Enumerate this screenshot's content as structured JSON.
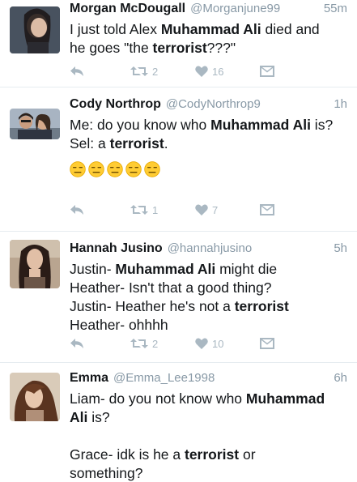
{
  "tweets": [
    {
      "name": "Morgan McDougall",
      "handle": "@Morganjune99",
      "time": "55m",
      "lines": [
        [
          {
            "t": "I just told Alex "
          },
          {
            "t": "Muhammad Ali",
            "b": true
          },
          {
            "t": " died and"
          }
        ],
        [
          {
            "t": "he goes \"the "
          },
          {
            "t": "terrorist",
            "b": true
          },
          {
            "t": "???\""
          }
        ]
      ],
      "retweets": "2",
      "likes": "16"
    },
    {
      "name": "Cody Northrop",
      "handle": "@CodyNorthrop9",
      "time": "1h",
      "lines": [
        [
          {
            "t": "Me: do you know who "
          },
          {
            "t": "Muhammad Ali",
            "b": true
          },
          {
            "t": " is?"
          }
        ],
        [
          {
            "t": "Sel: a "
          },
          {
            "t": "terrorist",
            "b": true
          },
          {
            "t": "."
          }
        ]
      ],
      "emoji": [
        "😑",
        "😑",
        "😑",
        "😑",
        "😑"
      ],
      "retweets": "1",
      "likes": "7"
    },
    {
      "name": "Hannah Jusino",
      "handle": "@hannahjusino",
      "time": "5h",
      "lines": [
        [
          {
            "t": "Justin- "
          },
          {
            "t": "Muhammad Ali",
            "b": true
          },
          {
            "t": " might die"
          }
        ],
        [
          {
            "t": "Heather- Isn't that a good thing?"
          }
        ],
        [
          {
            "t": "Justin- Heather he's not a "
          },
          {
            "t": "terrorist",
            "b": true
          }
        ],
        [
          {
            "t": "Heather- ohhhh"
          }
        ]
      ],
      "retweets": "2",
      "likes": "10"
    },
    {
      "name": "Emma",
      "handle": "@Emma_Lee1998",
      "time": "6h",
      "lines": [
        [
          {
            "t": "Liam- do you not know who "
          },
          {
            "t": "Muhammad",
            "b": true
          }
        ],
        [
          {
            "t": "Ali",
            "b": true
          },
          {
            "t": " is?"
          }
        ],
        [
          {
            "t": ""
          }
        ],
        [
          {
            "t": "Grace- idk is he a "
          },
          {
            "t": "terrorist",
            "b": true
          },
          {
            "t": " or"
          }
        ],
        [
          {
            "t": "something?"
          }
        ]
      ]
    }
  ],
  "colors": {
    "name": "#14171a",
    "muted": "#8899a6",
    "action_icon": "#aab8c2",
    "divider": "#e6ecf0"
  },
  "icons": [
    "reply-icon",
    "retweet-icon",
    "like-icon",
    "direct-message-icon"
  ]
}
